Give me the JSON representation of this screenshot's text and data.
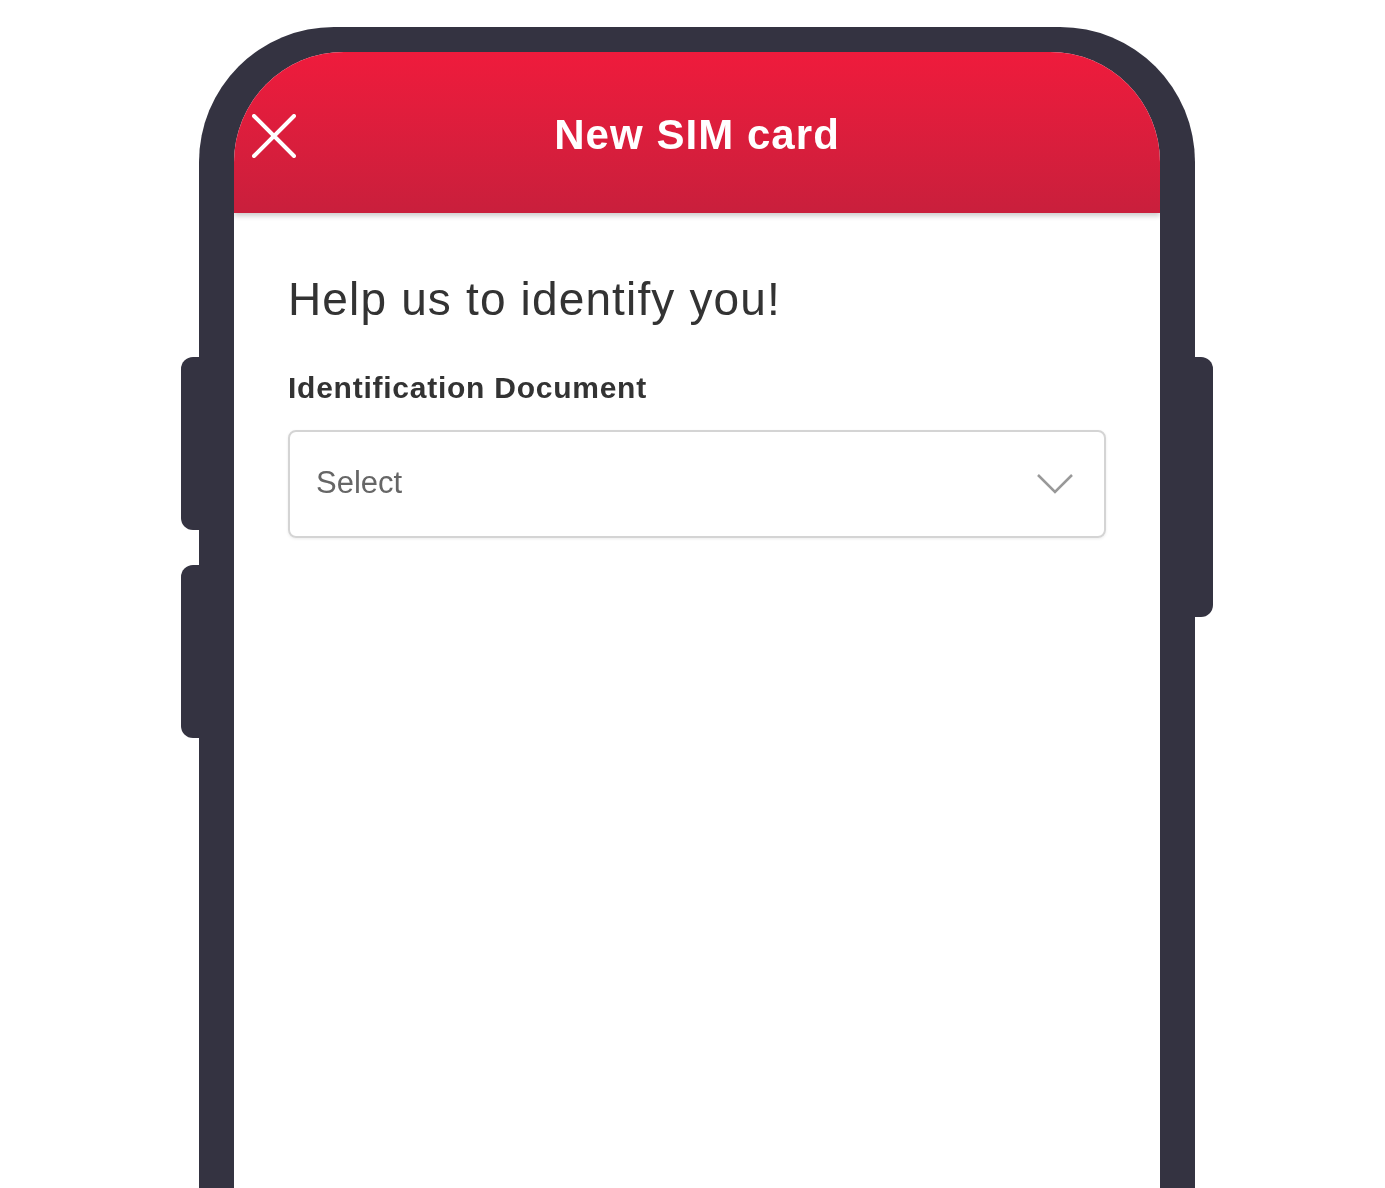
{
  "header": {
    "title": "New SIM card"
  },
  "heading": "Help us to identify you!",
  "fields": [
    {
      "label": "Identification Document",
      "placeholder": "Select"
    }
  ]
}
